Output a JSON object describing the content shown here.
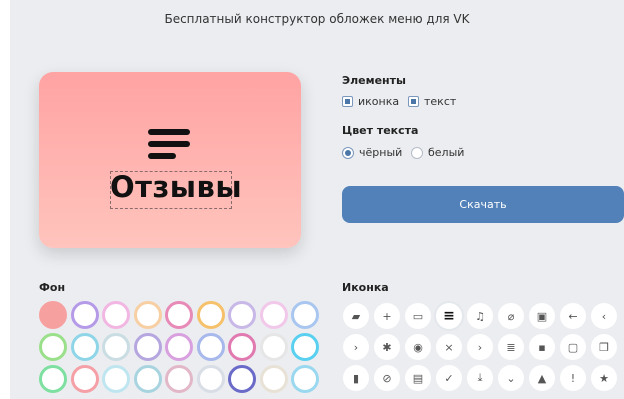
{
  "header": {
    "title": "Бесплатный конструктор обложек меню для VK"
  },
  "preview": {
    "label": "Отзывы",
    "bg_top": "#ffa3a3",
    "bg_bottom": "#ffc4bd"
  },
  "settings": {
    "elements_heading": "Элементы",
    "elements": [
      {
        "label": "иконка",
        "checked": true
      },
      {
        "label": "текст",
        "checked": true
      }
    ],
    "text_color_heading": "Цвет текста",
    "text_colors": [
      {
        "label": "чёрный",
        "selected": true
      },
      {
        "label": "белый",
        "selected": false
      }
    ],
    "download_label": "Скачать",
    "accent": "#5181b8"
  },
  "background": {
    "heading": "Фон",
    "swatches": [
      [
        "#f7a0a0",
        "#b59ae8",
        "#f2b6e2",
        "#f7cfa3",
        "#e88ab8",
        "#f5c26b",
        "#c8b8e8",
        "#f1c8ea",
        "#a8c6f0"
      ],
      [
        "#9ae08a",
        "#8fd5e8",
        "#c9dde2",
        "#b6a6e0",
        "#d9a0e0",
        "#a7b8ec",
        "#e07ab0",
        "#e6e6e6",
        "#5ad0f0"
      ],
      [
        "#7ee0a0",
        "#f59fa6",
        "#bfe6f0",
        "#a8d4e0",
        "#e2b8c8",
        "#d8dde6",
        "#6a6ac8",
        "#e8e2d6",
        "#9ad8f0"
      ]
    ]
  },
  "icon_picker": {
    "heading": "Иконка",
    "icons": [
      [
        "chat-icon",
        "plus-icon",
        "screen-icon",
        "menu-icon",
        "music-icon",
        "paperclip-icon",
        "gallery-icon",
        "arrow-left-icon",
        "chevron-left-icon"
      ],
      [
        "chevron-right-icon",
        "bug-icon",
        "camera-icon",
        "close-icon",
        "arrow-right-icon",
        "database-icon",
        "message-icon",
        "speech-bubble-icon",
        "copy-icon"
      ],
      [
        "trash-icon",
        "block-icon",
        "document-icon",
        "check-icon",
        "download-icon",
        "chevron-down-icon",
        "graduation-cap-icon",
        "exclamation-icon",
        "star-icon"
      ]
    ],
    "selected": "menu-icon"
  }
}
